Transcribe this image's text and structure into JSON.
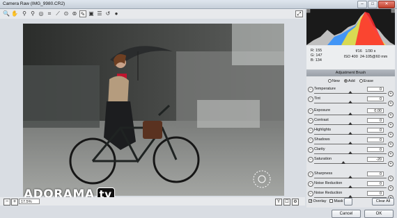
{
  "window": {
    "title": "Camera Raw (IMG_9980.CR2)",
    "minimize": "–",
    "maximize": "□",
    "close": "✕"
  },
  "toolbar": {
    "tools": [
      {
        "icon": "zoom-icon",
        "glyph": "🔍"
      },
      {
        "icon": "hand-icon",
        "glyph": "✋"
      },
      {
        "icon": "white-balance-icon",
        "glyph": "⚲"
      },
      {
        "icon": "color-sampler-icon",
        "glyph": "⚲"
      },
      {
        "icon": "target-adjust-icon",
        "glyph": "◎"
      },
      {
        "icon": "crop-icon",
        "glyph": "⌗"
      },
      {
        "icon": "straighten-icon",
        "glyph": "⟋"
      },
      {
        "icon": "spot-removal-icon",
        "glyph": "⊙"
      },
      {
        "icon": "red-eye-icon",
        "glyph": "⊚"
      },
      {
        "icon": "adjustment-brush-icon",
        "glyph": "✎"
      },
      {
        "icon": "graduated-filter-icon",
        "glyph": "▣"
      },
      {
        "icon": "preferences-icon",
        "glyph": "☰"
      },
      {
        "icon": "rotate-ccw-icon",
        "glyph": "↺"
      },
      {
        "icon": "rotate-cw-icon",
        "glyph": "●"
      }
    ],
    "fullscreen_glyph": "⤢"
  },
  "watermark": {
    "brand": "ADORAMA",
    "suffix": "tv"
  },
  "statusbar": {
    "zoom_minus": "−",
    "zoom_plus": "+",
    "zoom": "17.5%",
    "icons": [
      "Y",
      "☐",
      "⚙"
    ]
  },
  "readout": {
    "r": "R:  155",
    "g": "G:  147",
    "b": "B:  134",
    "aperture": "f/16",
    "shutter": "1/30 s",
    "iso": "ISO 400",
    "lens": "24-105@60 mm"
  },
  "panel": {
    "header": "Adjustment Brush",
    "modes": [
      {
        "label": "New",
        "on": false
      },
      {
        "label": "Add",
        "on": true
      },
      {
        "label": "Erase",
        "on": false
      }
    ]
  },
  "sliders": [
    {
      "label": "Temperature",
      "value": "0",
      "pos": 0.5
    },
    {
      "label": "Tint",
      "value": "0",
      "pos": 0.5
    },
    {
      "label": "Exposure",
      "value": "0.00",
      "pos": 0.5
    },
    {
      "label": "Contrast",
      "value": "0",
      "pos": 0.5
    },
    {
      "label": "Highlights",
      "value": "0",
      "pos": 0.5
    },
    {
      "label": "Shadows",
      "value": "0",
      "pos": 0.5
    },
    {
      "label": "Clarity",
      "value": "0",
      "pos": 0.5
    },
    {
      "label": "Saturation",
      "value": "-20",
      "pos": 0.4
    },
    {
      "label": "Sharpness",
      "value": "0",
      "pos": 0.5
    },
    {
      "label": "Noise Reduction",
      "value": "0",
      "pos": 0.5
    },
    {
      "label": "Noise Reduction",
      "value": "0",
      "pos": 0.5
    }
  ],
  "bottom": {
    "overlay": "Overlay",
    "mask": "Mask",
    "clear_all": "Clear All",
    "check": "✓"
  },
  "footer": {
    "cancel": "Cancel",
    "ok": "OK"
  }
}
